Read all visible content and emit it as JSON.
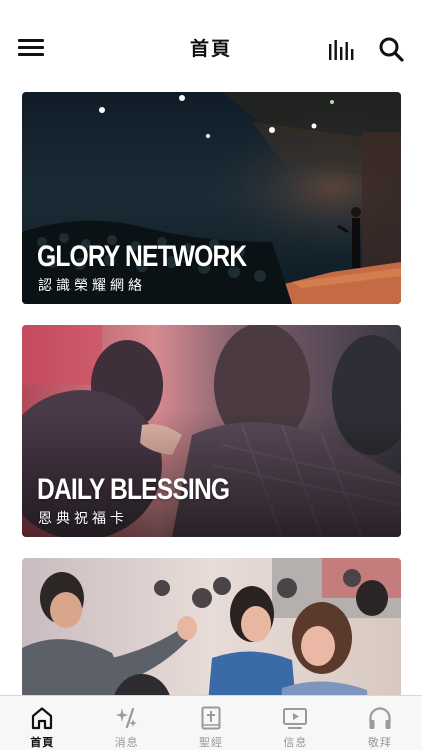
{
  "header": {
    "title": "首頁",
    "icons": {
      "menu": "hamburger-menu-icon",
      "audio": "audio-bars-icon",
      "search": "search-icon"
    }
  },
  "cards": [
    {
      "title": "GLORY NETWORK",
      "subtitle": "認識榮耀網絡",
      "image": "speaker-on-stage-photo"
    },
    {
      "title": "DAILY BLESSING",
      "subtitle": "恩典祝福卡",
      "image": "people-embracing-photo"
    },
    {
      "title": "",
      "subtitle": "",
      "image": "crowd-high-five-photo"
    }
  ],
  "tabbar": {
    "active_color": "#111111",
    "inactive_color": "#9a9a9a",
    "tabs": [
      {
        "label": "首頁",
        "icon": "home-icon",
        "active": true
      },
      {
        "label": "消息",
        "icon": "sparkle-icon",
        "active": false
      },
      {
        "label": "聖經",
        "icon": "bible-icon",
        "active": false
      },
      {
        "label": "信息",
        "icon": "video-icon",
        "active": false
      },
      {
        "label": "敬拜",
        "icon": "headphones-icon",
        "active": false
      }
    ]
  }
}
